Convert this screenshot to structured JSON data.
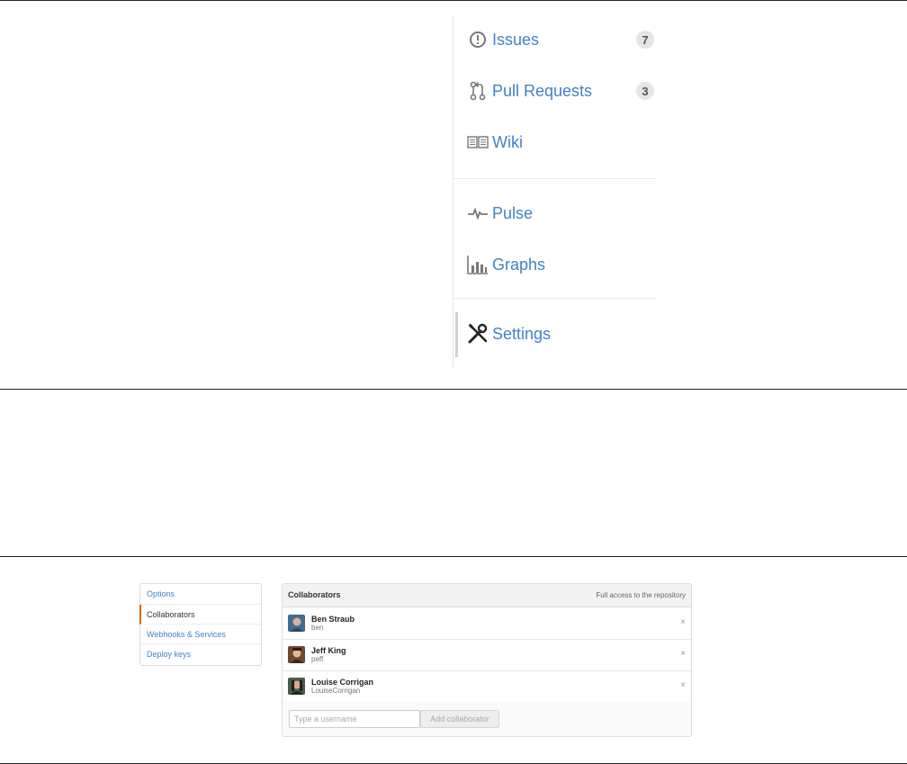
{
  "repo_nav": {
    "items": [
      {
        "label": "Issues",
        "icon": "issue-opened-icon",
        "count": "7"
      },
      {
        "label": "Pull Requests",
        "icon": "git-pull-request-icon",
        "count": "3"
      },
      {
        "label": "Wiki",
        "icon": "book-icon"
      },
      {
        "label": "Pulse",
        "icon": "pulse-icon"
      },
      {
        "label": "Graphs",
        "icon": "graph-icon"
      },
      {
        "label": "Settings",
        "icon": "tools-icon"
      }
    ]
  },
  "settings_menu": {
    "items": [
      {
        "label": "Options"
      },
      {
        "label": "Collaborators"
      },
      {
        "label": "Webhooks & Services"
      },
      {
        "label": "Deploy keys"
      }
    ]
  },
  "collaborators": {
    "title": "Collaborators",
    "note": "Full access to the repository",
    "people": [
      {
        "name": "Ben Straub",
        "login": "ben"
      },
      {
        "name": "Jeff King",
        "login": "peff"
      },
      {
        "name": "Louise Corrigan",
        "login": "LouiseCorrigan"
      }
    ],
    "remove_glyph": "×",
    "input_placeholder": "Type a username",
    "add_label": "Add collaborator"
  },
  "colors": {
    "link": "#4183c4",
    "accent": "#d26911",
    "text": "#333333"
  }
}
